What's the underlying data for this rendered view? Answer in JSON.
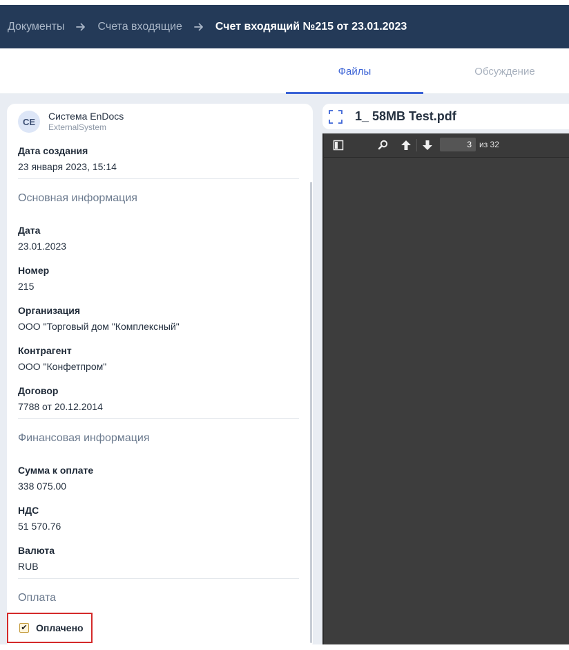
{
  "breadcrumb": {
    "items": [
      "Документы",
      "Счета входящие"
    ],
    "current": "Счет входящий №215 от 23.01.2023"
  },
  "tabs": {
    "files": "Файлы",
    "discussion": "Обсуждение"
  },
  "author": {
    "initials": "CE",
    "name": "Система EnDocs",
    "system": "ExternalSystem"
  },
  "created": {
    "label": "Дата создания",
    "value": "23 января 2023, 15:14"
  },
  "sections": {
    "main": "Основная информация",
    "finance": "Финансовая информация",
    "payment": "Оплата"
  },
  "fields": {
    "date": {
      "label": "Дата",
      "value": "23.01.2023"
    },
    "number": {
      "label": "Номер",
      "value": "215"
    },
    "organization": {
      "label": "Организация",
      "value": "ООО \"Торговый дом \"Комплексный\""
    },
    "counterparty": {
      "label": "Контрагент",
      "value": "ООО \"Конфетпром\""
    },
    "contract": {
      "label": "Договор",
      "value": "7788 от 20.12.2014"
    },
    "amount": {
      "label": "Сумма к оплате",
      "value": "338 075.00"
    },
    "vat": {
      "label": "НДС",
      "value": "51 570.76"
    },
    "currency": {
      "label": "Валюта",
      "value": "RUB"
    }
  },
  "payment": {
    "label": "Оплачено",
    "checked": true,
    "check_mark": "✔"
  },
  "viewer": {
    "filename": "1_ 58MB Test.pdf",
    "current_page": "3",
    "total_pages": "из 32"
  },
  "colors": {
    "header_bg": "#243a58",
    "accent": "#3b63d6",
    "highlight_border": "#d42a2a",
    "pdf_bg": "#3d3d3d"
  }
}
